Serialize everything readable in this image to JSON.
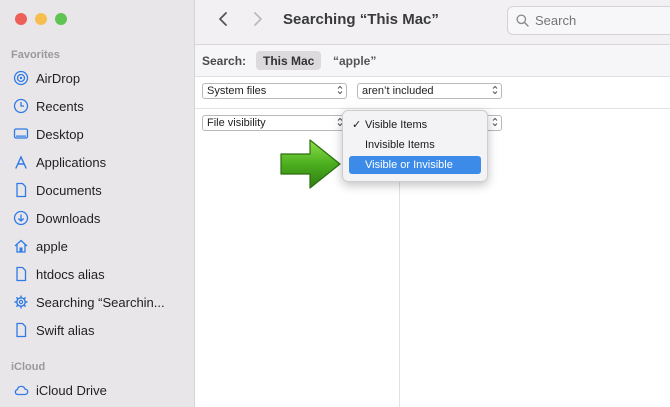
{
  "sidebar": {
    "favorites_header": "Favorites",
    "icloud_header": "iCloud",
    "items": [
      {
        "label": "AirDrop",
        "icon": "airdrop-icon"
      },
      {
        "label": "Recents",
        "icon": "clock-icon"
      },
      {
        "label": "Desktop",
        "icon": "desktop-icon"
      },
      {
        "label": "Applications",
        "icon": "applications-icon"
      },
      {
        "label": "Documents",
        "icon": "document-icon"
      },
      {
        "label": "Downloads",
        "icon": "download-icon"
      },
      {
        "label": "apple",
        "icon": "home-icon"
      },
      {
        "label": "htdocs alias",
        "icon": "document-icon"
      },
      {
        "label": "Searching “Searchin...",
        "icon": "gear-icon"
      },
      {
        "label": "Swift alias",
        "icon": "document-icon"
      }
    ],
    "icloud_items": [
      {
        "label": "iCloud Drive",
        "icon": "cloud-icon"
      }
    ]
  },
  "toolbar": {
    "title": "Searching “This Mac”",
    "search_placeholder": "Search"
  },
  "scope": {
    "label": "Search:",
    "this_mac": "This Mac",
    "term": "“apple”"
  },
  "criteria": {
    "row1": {
      "attribute": "System files",
      "condition": "aren’t included"
    },
    "row2": {
      "attribute": "File visibility"
    }
  },
  "menu": {
    "items": [
      {
        "label": "Visible Items",
        "checked": true,
        "check_mark": "✓"
      },
      {
        "label": "Invisible Items",
        "checked": false
      },
      {
        "label": "Visible or Invisible",
        "checked": false,
        "highlighted": true
      }
    ]
  },
  "colors": {
    "accent": "#2f7ae5",
    "highlight": "#3d8be8",
    "arrow_green": "#4cae1e"
  }
}
